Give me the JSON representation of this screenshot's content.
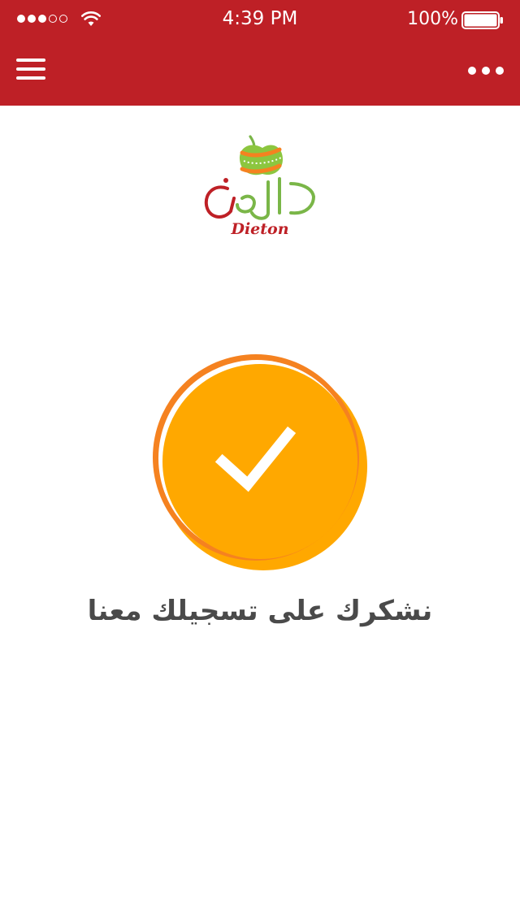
{
  "status_bar": {
    "time": "4:39 PM",
    "battery": "100%",
    "signal_filled": 3,
    "signal_total": 5
  },
  "header": {
    "menu_icon": "hamburger-menu-icon",
    "more_icon": "more-dots-icon",
    "color": "#be2026"
  },
  "logo": {
    "brand": "Dieton"
  },
  "success": {
    "icon": "checkmark-icon",
    "message": "نشكرك على تسجيلك معنا",
    "color": "#ffa800"
  }
}
